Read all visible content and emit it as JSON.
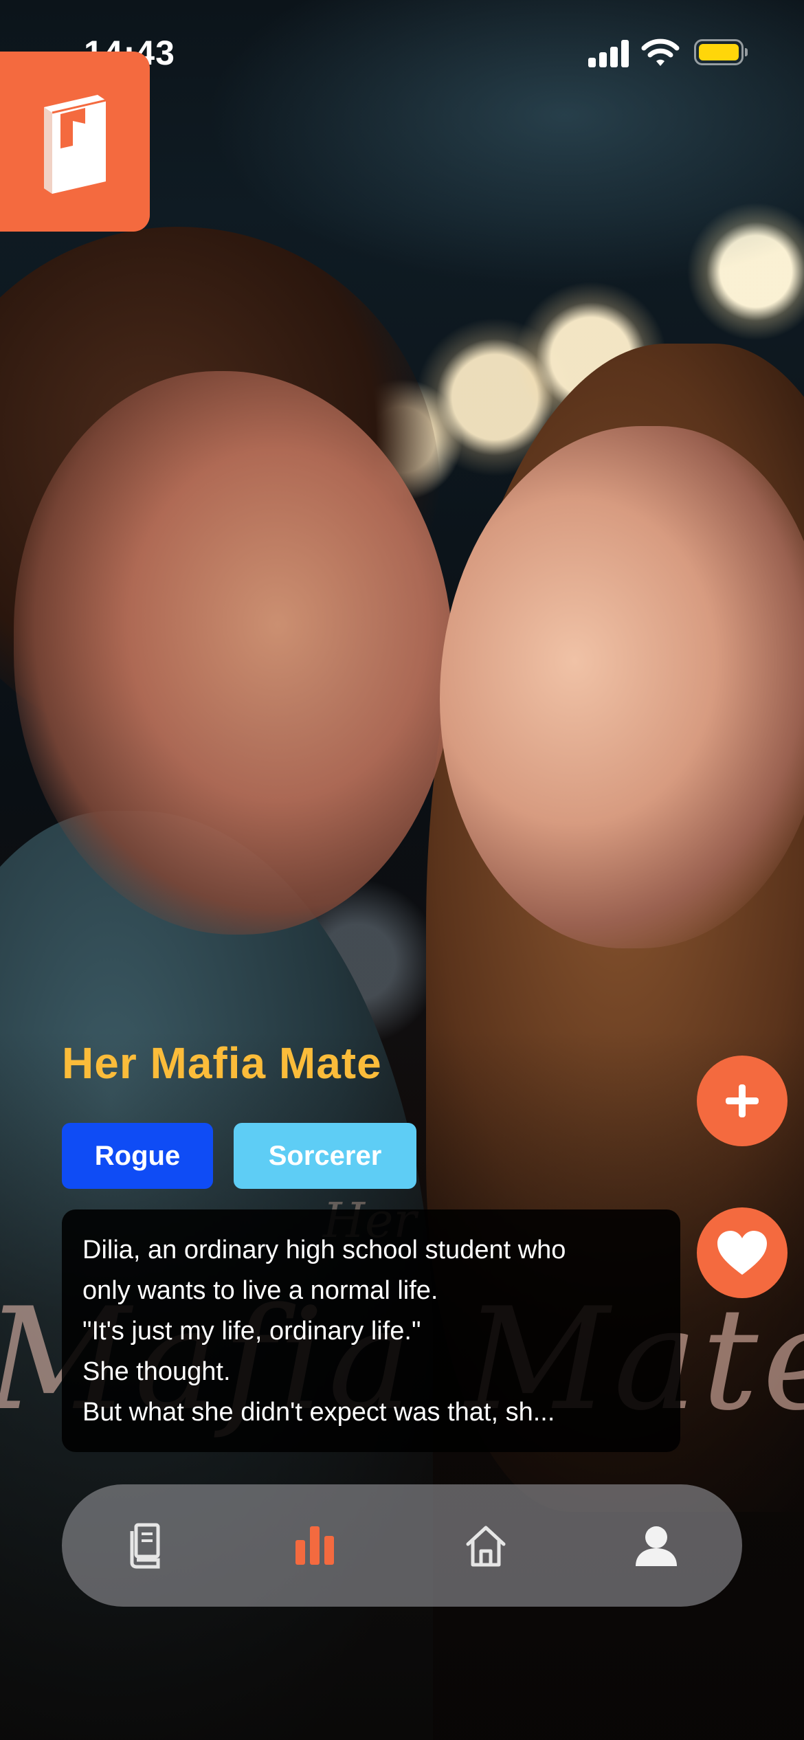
{
  "status_bar": {
    "time": "14:43"
  },
  "app": {
    "logo_icon": "book-icon",
    "accent": "#f46a3f"
  },
  "cover": {
    "title_art": "Mafia Mate",
    "subtitle_art": "Her"
  },
  "book": {
    "title": "Her Mafia Mate",
    "tags": [
      {
        "label": "Rogue",
        "color": "#0f4cf5"
      },
      {
        "label": "Sorcerer",
        "color": "#5ecdf5"
      }
    ],
    "synopsis_lines": [
      "Dilia, an ordinary high school student who",
      "only wants to live a normal life.",
      "\"It's just my life, ordinary life.\"",
      "She thought.",
      "But what she didn't expect was that, sh..."
    ]
  },
  "actions": {
    "add_icon": "plus-icon",
    "like_icon": "heart-icon"
  },
  "nav": {
    "items": [
      {
        "icon": "library-icon",
        "active": false
      },
      {
        "icon": "chart-icon",
        "active": true
      },
      {
        "icon": "home-icon",
        "active": false
      },
      {
        "icon": "profile-icon",
        "active": false
      }
    ],
    "active_color": "#f46a3f",
    "inactive_color": "#e6e6e6"
  }
}
